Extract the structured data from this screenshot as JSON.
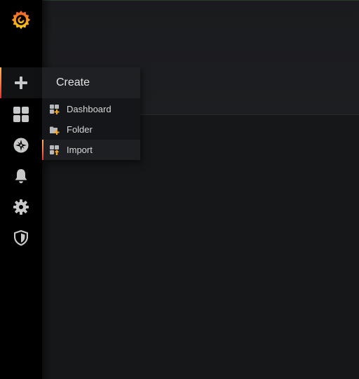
{
  "sidebar": {
    "logo_icon": "grafana-logo-icon",
    "items": [
      {
        "name": "create",
        "icon": "plus-icon",
        "active": true
      },
      {
        "name": "dashboards",
        "icon": "apps-grid-icon",
        "active": false
      },
      {
        "name": "explore",
        "icon": "compass-icon",
        "active": false
      },
      {
        "name": "alerting",
        "icon": "bell-icon",
        "active": false
      },
      {
        "name": "configuration",
        "icon": "gear-icon",
        "active": false
      },
      {
        "name": "server-admin",
        "icon": "shield-icon",
        "active": false
      }
    ]
  },
  "create_menu": {
    "title": "Create",
    "items": [
      {
        "label": "Dashboard",
        "icon": "dashboard-add-icon",
        "active": false
      },
      {
        "label": "Folder",
        "icon": "folder-add-icon",
        "active": false
      },
      {
        "label": "Import",
        "icon": "import-icon",
        "active": true
      }
    ]
  },
  "colors": {
    "accent_gradient_top": "#ffb357",
    "accent_gradient_mid": "#ff7941",
    "accent_gradient_bottom": "#e5312e",
    "sidebar_bg": "#000000",
    "page_bg": "#161719",
    "icon_gray": "#c7c8ca"
  }
}
